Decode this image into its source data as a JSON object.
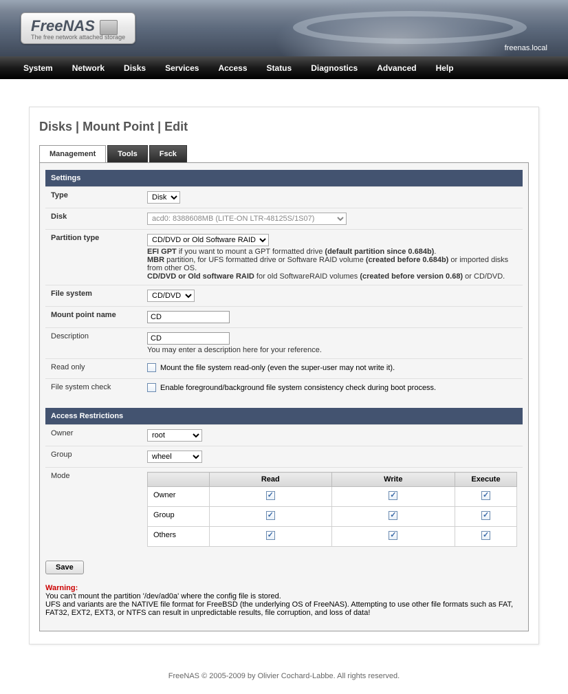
{
  "header": {
    "product": "FreeNAS",
    "tagline": "The free network attached storage",
    "hostname": "freenas.local"
  },
  "nav": [
    "System",
    "Network",
    "Disks",
    "Services",
    "Access",
    "Status",
    "Diagnostics",
    "Advanced",
    "Help"
  ],
  "breadcrumb": [
    "Disks",
    "Mount Point",
    "Edit"
  ],
  "tabs": [
    {
      "label": "Management",
      "active": true
    },
    {
      "label": "Tools",
      "active": false
    },
    {
      "label": "Fsck",
      "active": false
    }
  ],
  "sections": {
    "settings_title": "Settings",
    "type": {
      "label": "Type",
      "value": "Disk"
    },
    "disk": {
      "label": "Disk",
      "value": "acd0: 8388608MB (LITE-ON LTR-48125S/1S07)"
    },
    "partition": {
      "label": "Partition type",
      "value": "CD/DVD or Old Software RAID",
      "help_efi_pre": "EFI GPT",
      "help_efi_mid": " if you want to mount a GPT formatted drive ",
      "help_efi_bold": "(default partition since 0.684b)",
      "help_mbr_pre": "MBR",
      "help_mbr_mid": " partition, for UFS formatted drive or Software RAID volume ",
      "help_mbr_bold": "(created before 0.684b)",
      "help_mbr_end": " or imported disks from other OS.",
      "help_cd_pre": "CD/DVD or Old software RAID",
      "help_cd_mid": " for old SoftwareRAID volumes ",
      "help_cd_bold": "(created before version 0.68)",
      "help_cd_end": " or CD/DVD."
    },
    "fs": {
      "label": "File system",
      "value": "CD/DVD"
    },
    "mountname": {
      "label": "Mount point name",
      "value": "CD"
    },
    "description": {
      "label": "Description",
      "value": "CD",
      "help": "You may enter a description here for your reference."
    },
    "readonly": {
      "label": "Read only",
      "help": "Mount the file system read-only (even the super-user may not write it).",
      "checked": false
    },
    "fscheck": {
      "label": "File system check",
      "help": "Enable foreground/background file system consistency check during boot process.",
      "checked": false
    },
    "access_title": "Access Restrictions",
    "owner": {
      "label": "Owner",
      "value": "root"
    },
    "group": {
      "label": "Group",
      "value": "wheel"
    },
    "mode": {
      "label": "Mode",
      "headers": [
        "",
        "Read",
        "Write",
        "Execute"
      ],
      "rows": [
        {
          "label": "Owner",
          "read": true,
          "write": true,
          "execute": true
        },
        {
          "label": "Group",
          "read": true,
          "write": true,
          "execute": true
        },
        {
          "label": "Others",
          "read": true,
          "write": true,
          "execute": true
        }
      ]
    }
  },
  "save_label": "Save",
  "warning": {
    "title": "Warning:",
    "line1": "You can't mount the partition '/dev/ad0a' where the config file is stored.",
    "line2": "UFS and variants are the NATIVE file format for FreeBSD (the underlying OS of FreeNAS). Attempting to use other file formats such as FAT, FAT32, EXT2, EXT3, or NTFS can result in unpredictable results, file corruption, and loss of data!"
  },
  "footer": "FreeNAS © 2005-2009 by Olivier Cochard-Labbe. All rights reserved."
}
